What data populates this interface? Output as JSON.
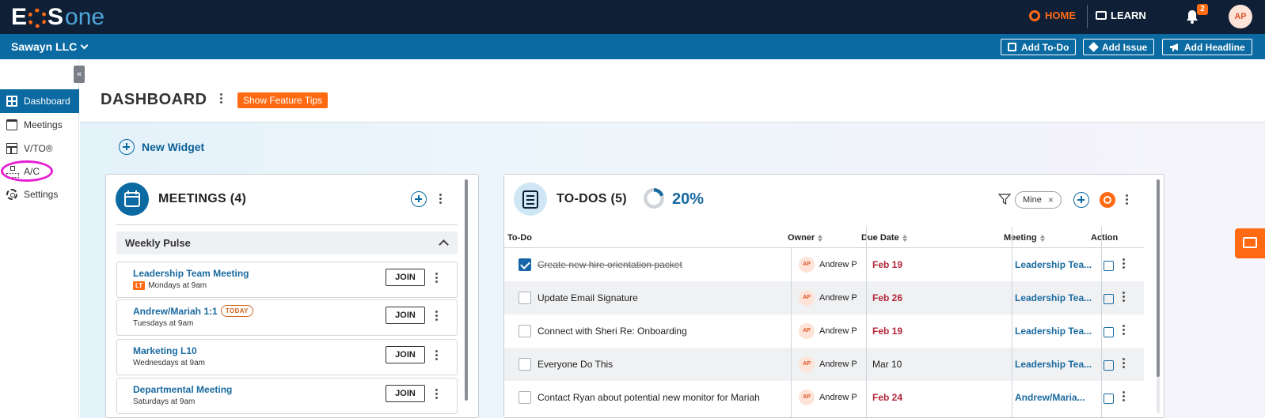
{
  "topbar": {
    "logo_eo": "E",
    "logo_s": "S",
    "logo_one": "one",
    "home_label": "HOME",
    "learn_label": "LEARN",
    "notification_count": "2",
    "user_initials": "AP"
  },
  "subbar": {
    "company": "Sawayn LLC",
    "add_todo": "Add To-Do",
    "add_issue": "Add Issue",
    "add_headline": "Add Headline"
  },
  "sidebar": {
    "collapse": "«",
    "items": [
      {
        "label": "Dashboard",
        "active": true
      },
      {
        "label": "Meetings"
      },
      {
        "label": "V/TO®"
      },
      {
        "label": "A/C"
      },
      {
        "label": "Settings"
      }
    ]
  },
  "main": {
    "title": "DASHBOARD",
    "feature_tips": "Show Feature Tips",
    "new_widget": "New Widget"
  },
  "meetings": {
    "title": "MEETINGS (4)",
    "section": "Weekly Pulse",
    "join_label": "JOIN",
    "rows": [
      {
        "name": "Leadership Team Meeting",
        "badge": "LT",
        "schedule": "Mondays at 9am"
      },
      {
        "name": "Andrew/Mariah 1:1",
        "today": "TODAY",
        "schedule": "Tuesdays at 9am"
      },
      {
        "name": "Marketing L10",
        "schedule": "Wednesdays at 9am"
      },
      {
        "name": "Departmental Meeting",
        "schedule": "Saturdays at 9am"
      }
    ]
  },
  "todos": {
    "title": "TO-DOS (5)",
    "percent_label": "20%",
    "percent_value": 20,
    "filter_chip": "Mine",
    "chip_close": "×",
    "columns": [
      "To-Do",
      "Owner",
      "Due Date",
      "Meeting",
      "Action"
    ],
    "rows": [
      {
        "text": "Create new hire orientation packet",
        "done": true,
        "owner_initials": "AP",
        "owner": "Andrew P",
        "due": "Feb 19",
        "overdue": true,
        "meeting": "Leadership Tea..."
      },
      {
        "text": "Update Email Signature",
        "done": false,
        "owner_initials": "AP",
        "owner": "Andrew P",
        "due": "Feb 26",
        "overdue": true,
        "meeting": "Leadership Tea..."
      },
      {
        "text": "Connect with Sheri Re: Onboarding",
        "done": false,
        "owner_initials": "AP",
        "owner": "Andrew P",
        "due": "Feb 19",
        "overdue": true,
        "meeting": "Leadership Tea..."
      },
      {
        "text": "Everyone Do This",
        "done": false,
        "owner_initials": "AP",
        "owner": "Andrew P",
        "due": "Mar 10",
        "overdue": false,
        "meeting": "Leadership Tea..."
      },
      {
        "text": "Contact Ryan about potential new monitor for Mariah",
        "done": false,
        "owner_initials": "AP",
        "owner": "Andrew P",
        "due": "Feb 24",
        "overdue": true,
        "meeting": "Andrew/Maria..."
      }
    ]
  },
  "colors": {
    "navy": "#0f1f35",
    "brand_blue": "#0b6aa2",
    "accent_orange": "#ff6a13",
    "overdue_red": "#b3263a",
    "annotation_magenta": "#e61fd3"
  }
}
